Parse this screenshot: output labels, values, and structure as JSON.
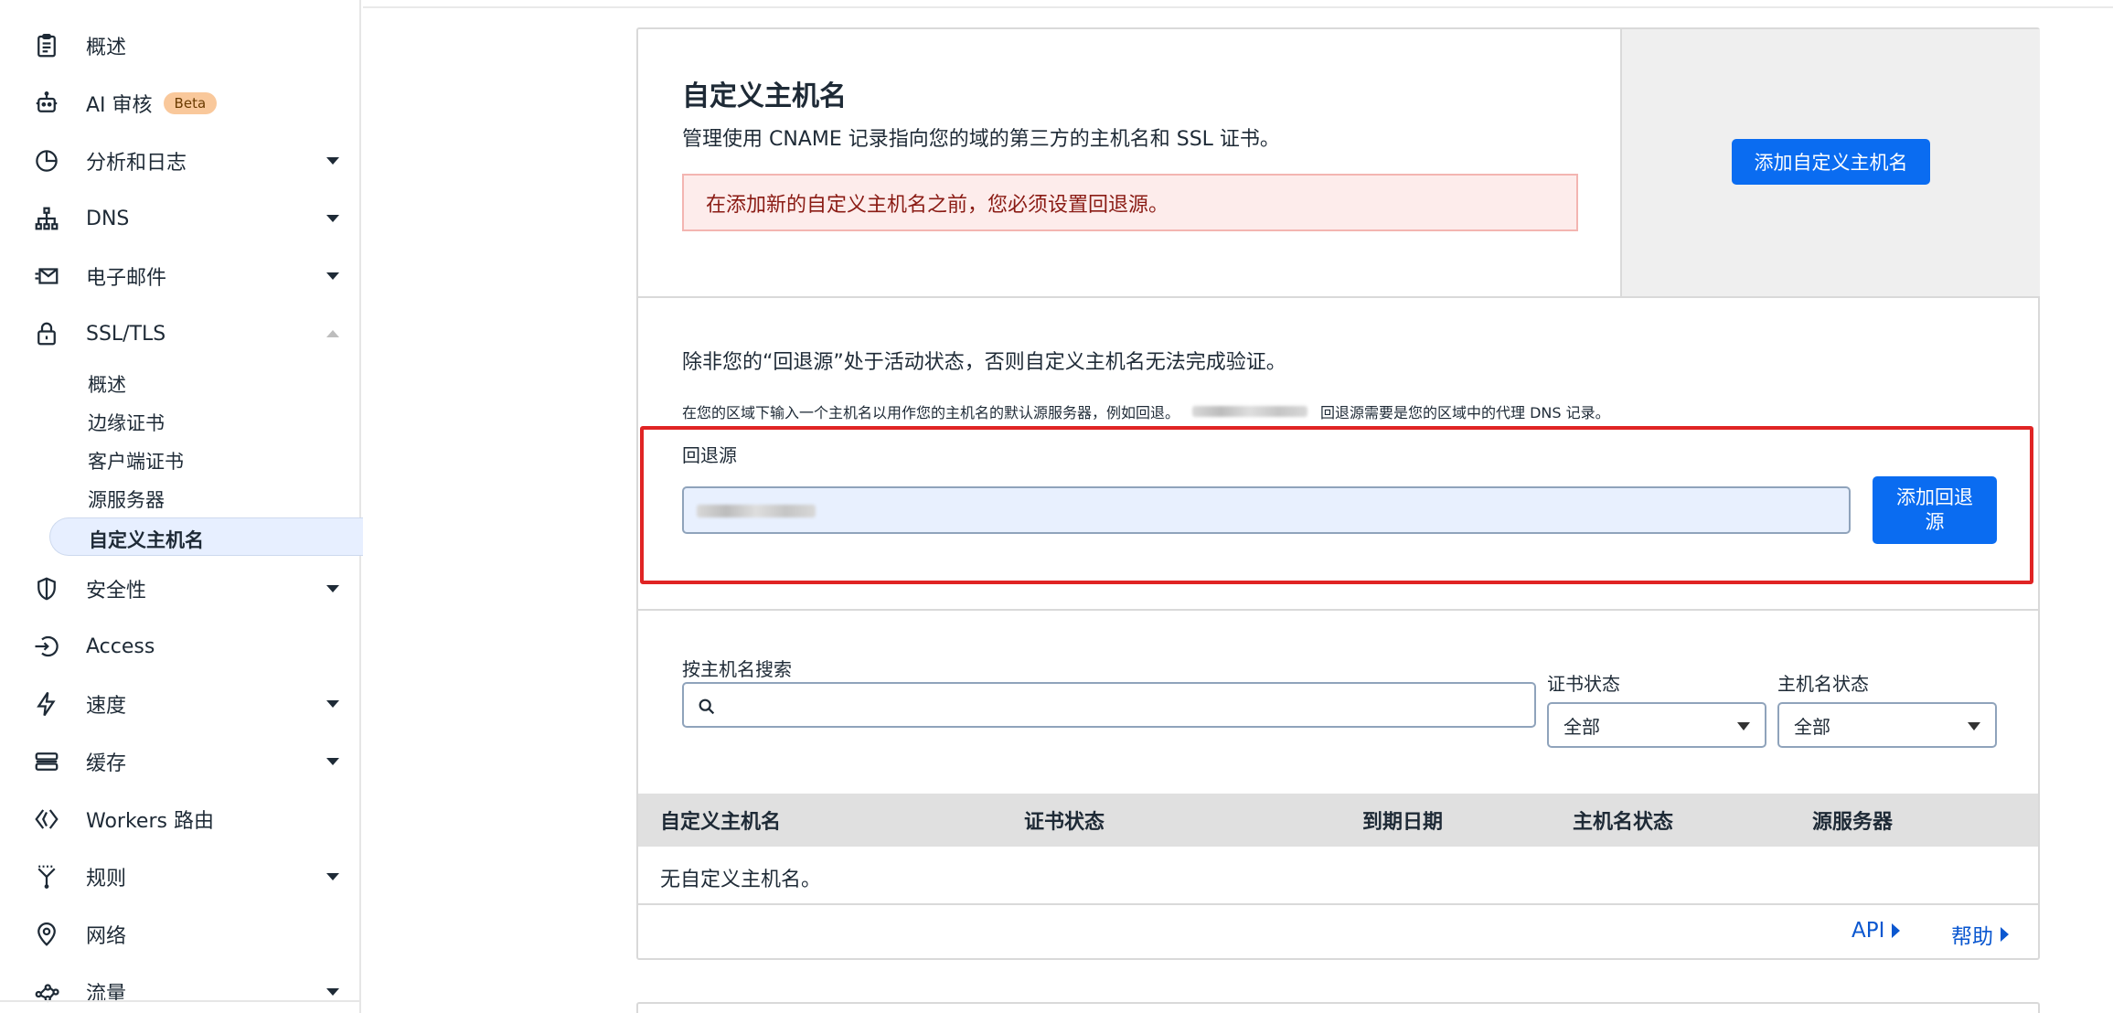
{
  "sidebar": {
    "items": [
      {
        "label": "概述",
        "icon": "clipboard-icon",
        "caret": "none"
      },
      {
        "label": "AI 审核",
        "icon": "robot-icon",
        "caret": "none",
        "badge": "Beta"
      },
      {
        "label": "分析和日志",
        "icon": "pie-chart-icon",
        "caret": "down"
      },
      {
        "label": "DNS",
        "icon": "network-tree-icon",
        "caret": "down"
      },
      {
        "label": "电子邮件",
        "icon": "email-icon",
        "caret": "down"
      },
      {
        "label": "SSL/TLS",
        "icon": "lock-icon",
        "caret": "up"
      },
      {
        "label": "安全性",
        "icon": "shield-icon",
        "caret": "down"
      },
      {
        "label": "Access",
        "icon": "access-icon",
        "caret": "none"
      },
      {
        "label": "速度",
        "icon": "lightning-icon",
        "caret": "down"
      },
      {
        "label": "缓存",
        "icon": "storage-icon",
        "caret": "down"
      },
      {
        "label": "Workers 路由",
        "icon": "workers-icon",
        "caret": "none"
      },
      {
        "label": "规则",
        "icon": "rules-icon",
        "caret": "down"
      },
      {
        "label": "网络",
        "icon": "location-pin-icon",
        "caret": "none"
      },
      {
        "label": "流量",
        "icon": "traffic-icon",
        "caret": "down"
      }
    ],
    "ssl_sub_items": [
      "概述",
      "边缘证书",
      "客户端证书",
      "源服务器",
      "自定义主机名"
    ]
  },
  "header": {
    "title": "自定义主机名",
    "subtitle": "管理使用 CNAME 记录指向您的域的第三方的主机名和 SSL 证书。",
    "alert": "在添加新的自定义主机名之前，您必须设置回退源。",
    "add_button": "添加自定义主机名"
  },
  "fallback": {
    "note": "除非您的“回退源”处于活动状态，否则自定义主机名无法完成验证。",
    "small_prefix": "在您的区域下输入一个主机名以用作您的主机名的默认源服务器，例如回退。",
    "small_suffix": "回退源需要是您的区域中的代理 DNS 记录。",
    "label": "回退源",
    "add_button": "添加回退源"
  },
  "filters": {
    "search_label": "按主机名搜索",
    "search_placeholder": "",
    "cert_status_label": "证书状态",
    "cert_status_value": "全部",
    "host_status_label": "主机名状态",
    "host_status_value": "全部"
  },
  "table": {
    "columns": [
      "自定义主机名",
      "证书状态",
      "到期日期",
      "主机名状态",
      "源服务器"
    ],
    "empty_text": "无自定义主机名。"
  },
  "footer": {
    "api_link": "API",
    "help_link": "帮助"
  },
  "colors": {
    "primary": "#0a6cf1",
    "alert_bg": "#fdeceb",
    "highlight": "#e02424",
    "beta_badge": "#f9c89b"
  }
}
